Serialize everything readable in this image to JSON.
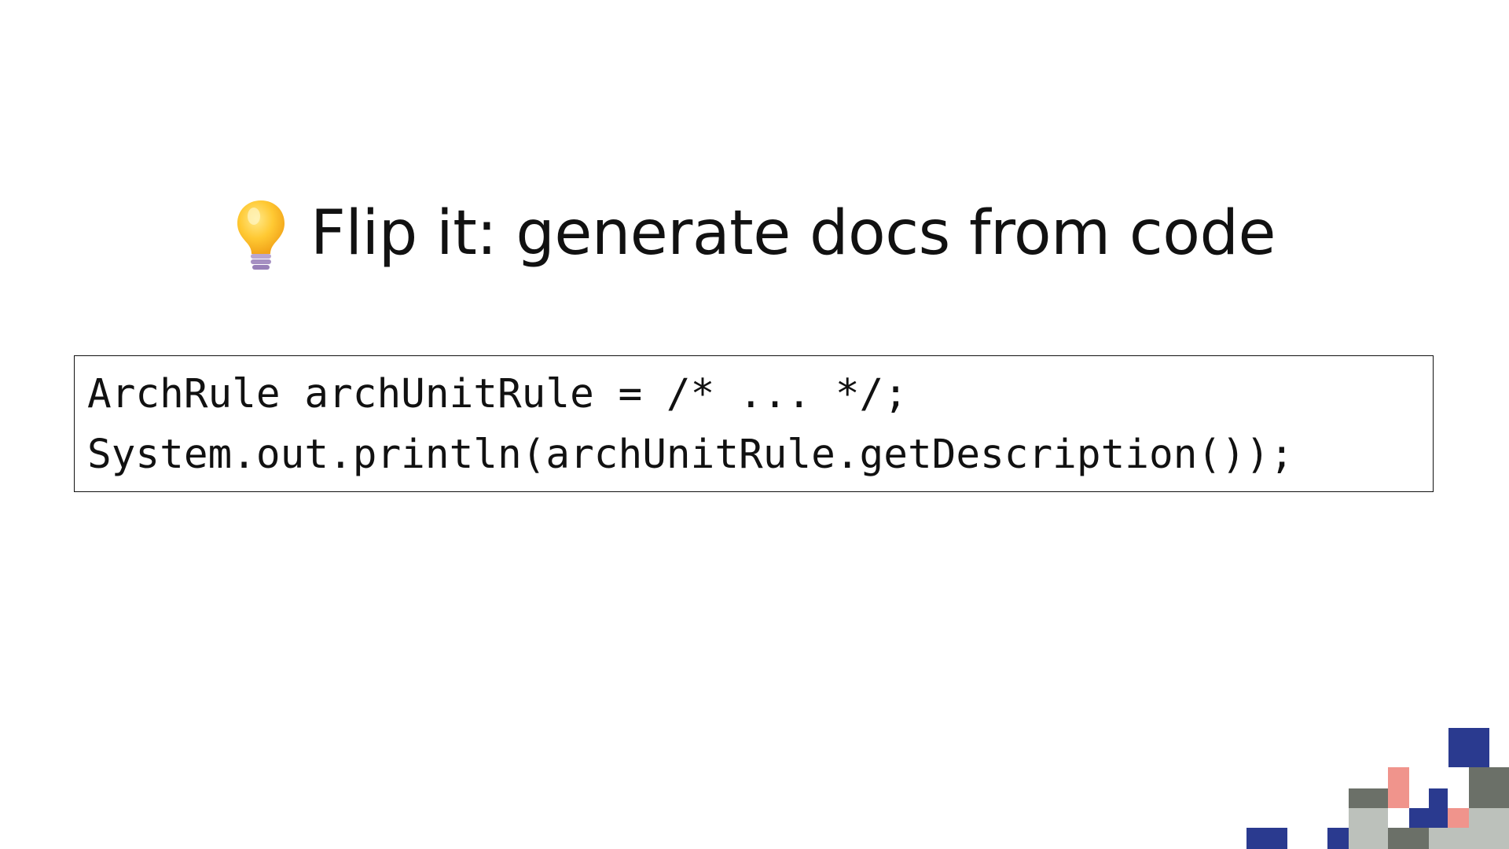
{
  "slide": {
    "title_icon": "lightbulb-icon",
    "title": "Flip it: generate docs from code",
    "code_lines": [
      "ArchRule archUnitRule = /* ... */;",
      "System.out.println(archUnitRule.getDescription());"
    ]
  },
  "colors": {
    "background": "#ffffff",
    "text": "#111111",
    "deco_blue": "#2a3a8f",
    "deco_dark_gray": "#6b7068",
    "deco_light_gray": "#bcc1bb",
    "deco_pink": "#f0948c"
  }
}
